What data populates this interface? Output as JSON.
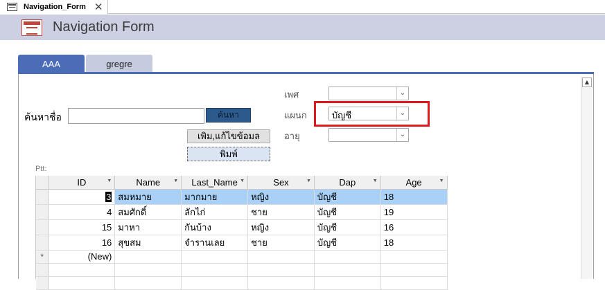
{
  "doc_tab": {
    "title": "Navigation_Form",
    "close": "✕"
  },
  "header": {
    "title": "Navigation Form"
  },
  "nav_tabs": [
    {
      "label": "AAA"
    },
    {
      "label": "gregre"
    }
  ],
  "search": {
    "label": "ค้นหาชื่อ",
    "value": "",
    "button": "ค้นหา"
  },
  "buttons": {
    "edit": "เพิม,แก้ไขข้อมล",
    "print": "พิมพ์"
  },
  "filters": {
    "sex": {
      "label": "เพศ",
      "value": ""
    },
    "dept": {
      "label": "แผนก",
      "value": "บัญชี"
    },
    "age": {
      "label": "อายุ",
      "value": ""
    }
  },
  "subform_label": "Ptt:",
  "grid": {
    "columns": [
      "ID",
      "Name",
      "Last_Name",
      "Sex",
      "Dap",
      "Age"
    ],
    "rows": [
      [
        "3",
        "สมหมาย",
        "มากมาย",
        "หญิง",
        "บัญชี",
        "18"
      ],
      [
        "4",
        "สมศักดิ์",
        "ลักไก่",
        "ชาย",
        "บัญชี",
        "19"
      ],
      [
        "15",
        "มาหา",
        "กันบ้าง",
        "หญิง",
        "บัญชี",
        "16"
      ],
      [
        "16",
        "สุขสม",
        "จำรานเลย",
        "ชาย",
        "บัญชี",
        "18"
      ]
    ],
    "new_row_marker": "*",
    "new_row_label": "(New)"
  },
  "colors": {
    "accent": "#4b6cb7",
    "header_bg": "#cdcfe3",
    "highlight": "#e0191e",
    "selected_row": "#a9d1f7"
  },
  "icons": {
    "form": "form-icon",
    "dropdown": "chevron-down-icon",
    "sort": "sort-arrow-icon"
  }
}
